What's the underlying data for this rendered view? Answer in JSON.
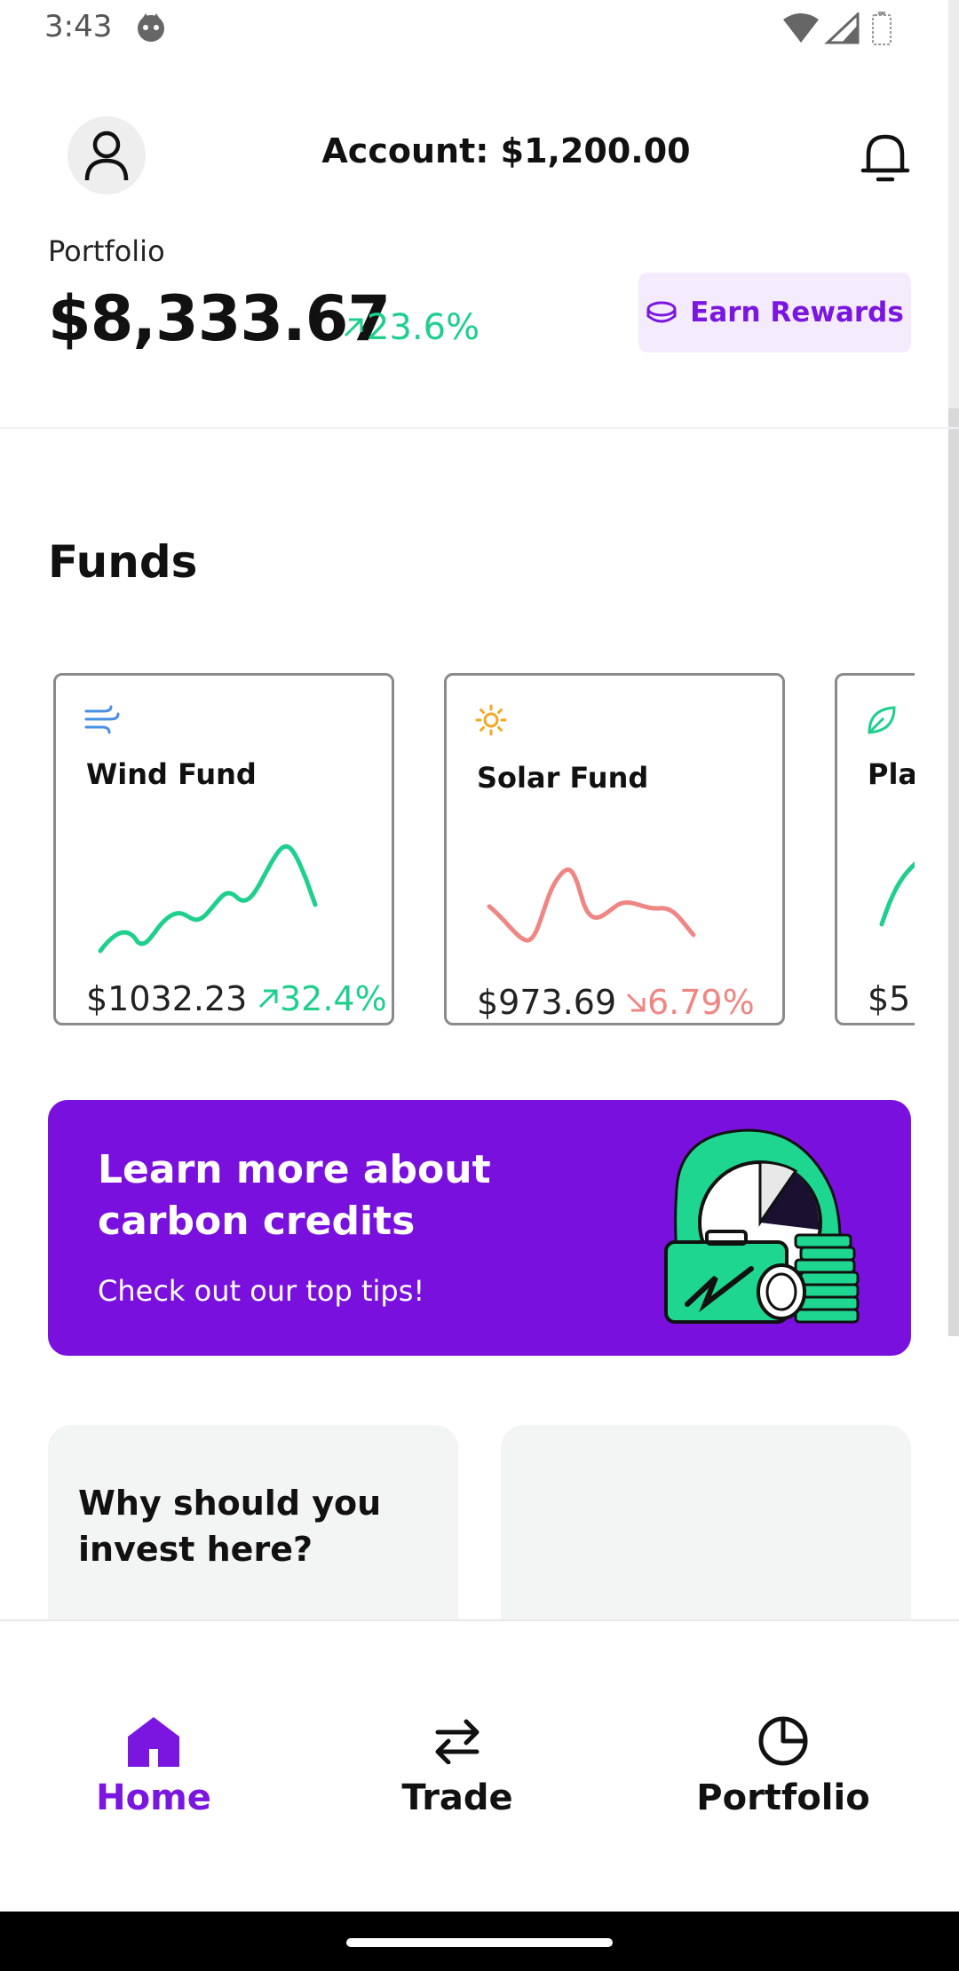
{
  "status_bar": {
    "time": "3:43"
  },
  "header": {
    "account_label": "Account: $1,200.00"
  },
  "portfolio": {
    "label": "Portfolio",
    "value": "$8,333.67",
    "change": "23.6%",
    "earn_rewards_label": "Earn Rewards"
  },
  "funds": {
    "title": "Funds",
    "items": [
      {
        "name": "Wind Fund",
        "price": "$1032.23",
        "change": "32.4%",
        "direction": "up",
        "color": "#1fcf8d"
      },
      {
        "name": "Solar Fund",
        "price": "$973.69",
        "change": "6.79%",
        "direction": "down",
        "color": "#ef8683"
      },
      {
        "name": "Plan",
        "price": "$5",
        "change": "",
        "direction": "up",
        "color": "#1fcf8d"
      }
    ]
  },
  "banner": {
    "title": "Learn more about carbon credits",
    "subtitle": "Check out our top tips!"
  },
  "info_cards": [
    {
      "title": "Why should you invest here?"
    },
    {
      "title": ""
    }
  ],
  "bottom_nav": {
    "items": [
      {
        "label": "Home",
        "active": true
      },
      {
        "label": "Trade",
        "active": false
      },
      {
        "label": "Portfolio",
        "active": false
      }
    ]
  },
  "colors": {
    "accent": "#7a16e0",
    "positive": "#1fcf8d",
    "negative": "#ef8683"
  }
}
